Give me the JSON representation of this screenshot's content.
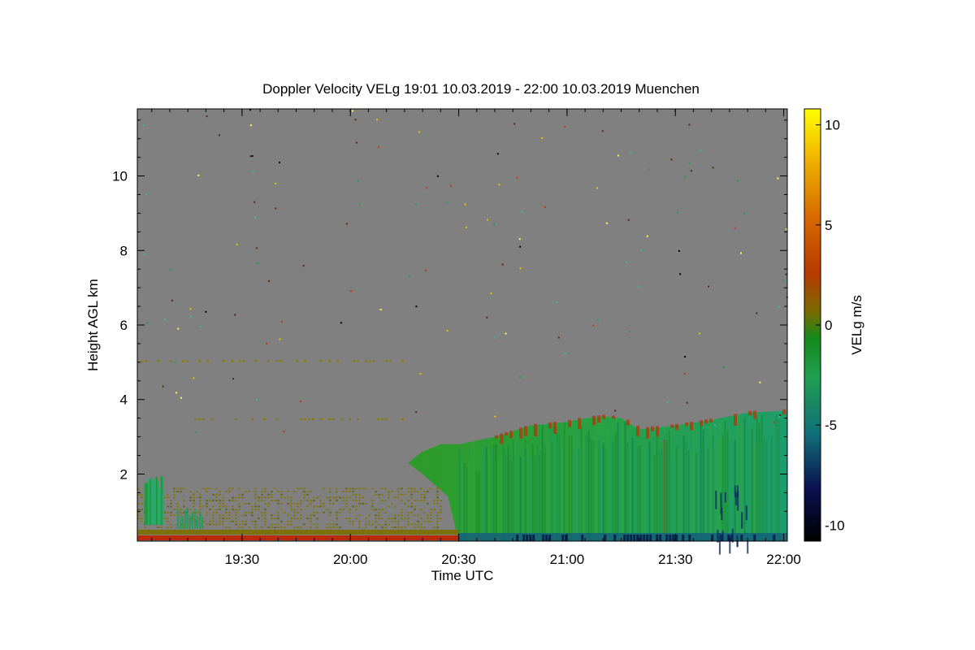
{
  "chart_data": {
    "type": "heatmap",
    "title": "Doppler Velocity VELg   19:01 10.03.2019 - 22:00 10.03.2019 Muenchen",
    "xlabel": "Time UTC",
    "ylabel": "Height AGL km",
    "colorbar_label": "VELg m/s",
    "x_range": [
      "19:01",
      "22:01"
    ],
    "x_ticks": [
      "19:30",
      "20:00",
      "20:30",
      "21:00",
      "21:30",
      "22:00"
    ],
    "y_range_km": [
      0.2,
      11.8
    ],
    "y_ticks": [
      "2",
      "4",
      "6",
      "8",
      "10"
    ],
    "colorbar_range": [
      -10.8,
      10.8
    ],
    "colorbar_ticks": [
      "10",
      "5",
      "0",
      "-5",
      "-10"
    ],
    "colormap": [
      "#000000",
      "#0a1050",
      "#10707a",
      "#20a050",
      "#148a1a",
      "#7a6a00",
      "#b83a00",
      "#d86a00",
      "#f0b000",
      "#ffff00"
    ],
    "background_color": "#808080",
    "cloud_top_km": [
      {
        "t": "20:16",
        "h": 2.3
      },
      {
        "t": "20:20",
        "h": 2.6
      },
      {
        "t": "20:25",
        "h": 2.8
      },
      {
        "t": "20:30",
        "h": 2.8
      },
      {
        "t": "20:40",
        "h": 3.0
      },
      {
        "t": "20:50",
        "h": 3.3
      },
      {
        "t": "21:00",
        "h": 3.4
      },
      {
        "t": "21:05",
        "h": 3.5
      },
      {
        "t": "21:10",
        "h": 3.55
      },
      {
        "t": "21:15",
        "h": 3.5
      },
      {
        "t": "21:20",
        "h": 3.2
      },
      {
        "t": "21:30",
        "h": 3.3
      },
      {
        "t": "21:40",
        "h": 3.45
      },
      {
        "t": "21:50",
        "h": 3.65
      },
      {
        "t": "22:01",
        "h": 3.7
      }
    ]
  }
}
